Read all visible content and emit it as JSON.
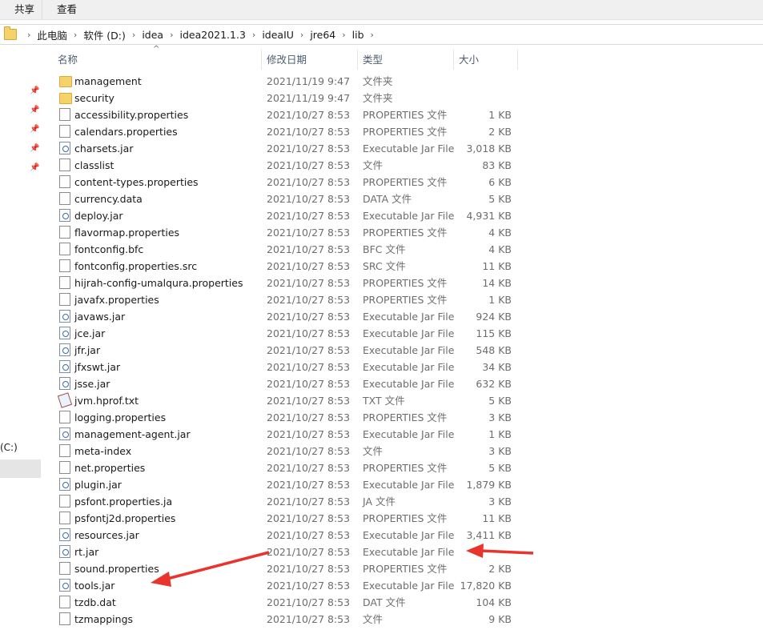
{
  "ribbon": {
    "share": "共享",
    "view": "查看"
  },
  "breadcrumb": [
    "此电脑",
    "软件 (D:)",
    "idea",
    "idea2021.1.3",
    "ideaIU",
    "jre64",
    "lib"
  ],
  "nav": {
    "drive_label": "(C:)"
  },
  "columns": {
    "name": "名称",
    "date": "修改日期",
    "type": "类型",
    "size": "大小"
  },
  "files": [
    {
      "name": "management",
      "date": "2021/11/19 9:47",
      "type": "文件夹",
      "size": "",
      "icon": "folder-icon"
    },
    {
      "name": "security",
      "date": "2021/11/19 9:47",
      "type": "文件夹",
      "size": "",
      "icon": "folder-icon"
    },
    {
      "name": "accessibility.properties",
      "date": "2021/10/27 8:53",
      "type": "PROPERTIES 文件",
      "size": "1 KB",
      "icon": "file-icon"
    },
    {
      "name": "calendars.properties",
      "date": "2021/10/27 8:53",
      "type": "PROPERTIES 文件",
      "size": "2 KB",
      "icon": "file-icon"
    },
    {
      "name": "charsets.jar",
      "date": "2021/10/27 8:53",
      "type": "Executable Jar File",
      "size": "3,018 KB",
      "icon": "jar-icon"
    },
    {
      "name": "classlist",
      "date": "2021/10/27 8:53",
      "type": "文件",
      "size": "83 KB",
      "icon": "file-icon"
    },
    {
      "name": "content-types.properties",
      "date": "2021/10/27 8:53",
      "type": "PROPERTIES 文件",
      "size": "6 KB",
      "icon": "file-icon"
    },
    {
      "name": "currency.data",
      "date": "2021/10/27 8:53",
      "type": "DATA 文件",
      "size": "5 KB",
      "icon": "file-icon"
    },
    {
      "name": "deploy.jar",
      "date": "2021/10/27 8:53",
      "type": "Executable Jar File",
      "size": "4,931 KB",
      "icon": "jar-icon"
    },
    {
      "name": "flavormap.properties",
      "date": "2021/10/27 8:53",
      "type": "PROPERTIES 文件",
      "size": "4 KB",
      "icon": "file-icon"
    },
    {
      "name": "fontconfig.bfc",
      "date": "2021/10/27 8:53",
      "type": "BFC 文件",
      "size": "4 KB",
      "icon": "file-icon"
    },
    {
      "name": "fontconfig.properties.src",
      "date": "2021/10/27 8:53",
      "type": "SRC 文件",
      "size": "11 KB",
      "icon": "file-icon"
    },
    {
      "name": "hijrah-config-umalqura.properties",
      "date": "2021/10/27 8:53",
      "type": "PROPERTIES 文件",
      "size": "14 KB",
      "icon": "file-icon"
    },
    {
      "name": "javafx.properties",
      "date": "2021/10/27 8:53",
      "type": "PROPERTIES 文件",
      "size": "1 KB",
      "icon": "file-icon"
    },
    {
      "name": "javaws.jar",
      "date": "2021/10/27 8:53",
      "type": "Executable Jar File",
      "size": "924 KB",
      "icon": "jar-icon"
    },
    {
      "name": "jce.jar",
      "date": "2021/10/27 8:53",
      "type": "Executable Jar File",
      "size": "115 KB",
      "icon": "jar-icon"
    },
    {
      "name": "jfr.jar",
      "date": "2021/10/27 8:53",
      "type": "Executable Jar File",
      "size": "548 KB",
      "icon": "jar-icon"
    },
    {
      "name": "jfxswt.jar",
      "date": "2021/10/27 8:53",
      "type": "Executable Jar File",
      "size": "34 KB",
      "icon": "jar-icon"
    },
    {
      "name": "jsse.jar",
      "date": "2021/10/27 8:53",
      "type": "Executable Jar File",
      "size": "632 KB",
      "icon": "jar-icon"
    },
    {
      "name": "jvm.hprof.txt",
      "date": "2021/10/27 8:53",
      "type": "TXT 文件",
      "size": "5 KB",
      "icon": "txt-icon"
    },
    {
      "name": "logging.properties",
      "date": "2021/10/27 8:53",
      "type": "PROPERTIES 文件",
      "size": "3 KB",
      "icon": "file-icon"
    },
    {
      "name": "management-agent.jar",
      "date": "2021/10/27 8:53",
      "type": "Executable Jar File",
      "size": "1 KB",
      "icon": "jar-icon"
    },
    {
      "name": "meta-index",
      "date": "2021/10/27 8:53",
      "type": "文件",
      "size": "3 KB",
      "icon": "file-icon"
    },
    {
      "name": "net.properties",
      "date": "2021/10/27 8:53",
      "type": "PROPERTIES 文件",
      "size": "5 KB",
      "icon": "file-icon"
    },
    {
      "name": "plugin.jar",
      "date": "2021/10/27 8:53",
      "type": "Executable Jar File",
      "size": "1,879 KB",
      "icon": "jar-icon"
    },
    {
      "name": "psfont.properties.ja",
      "date": "2021/10/27 8:53",
      "type": "JA 文件",
      "size": "3 KB",
      "icon": "file-icon"
    },
    {
      "name": "psfontj2d.properties",
      "date": "2021/10/27 8:53",
      "type": "PROPERTIES 文件",
      "size": "11 KB",
      "icon": "file-icon"
    },
    {
      "name": "resources.jar",
      "date": "2021/10/27 8:53",
      "type": "Executable Jar File",
      "size": "3,411 KB",
      "icon": "jar-icon"
    },
    {
      "name": "rt.jar",
      "date": "2021/10/27 8:53",
      "type": "Executable Jar File",
      "size": "",
      "icon": "jar-icon"
    },
    {
      "name": "sound.properties",
      "date": "2021/10/27 8:53",
      "type": "PROPERTIES 文件",
      "size": "2 KB",
      "icon": "file-icon"
    },
    {
      "name": "tools.jar",
      "date": "2021/10/27 8:53",
      "type": "Executable Jar File",
      "size": "17,820 KB",
      "icon": "jar-icon"
    },
    {
      "name": "tzdb.dat",
      "date": "2021/10/27 8:53",
      "type": "DAT 文件",
      "size": "104 KB",
      "icon": "file-icon"
    },
    {
      "name": "tzmappings",
      "date": "2021/10/27 8:53",
      "type": "文件",
      "size": "9 KB",
      "icon": "file-icon"
    }
  ],
  "annotation_color": "#e8342c"
}
